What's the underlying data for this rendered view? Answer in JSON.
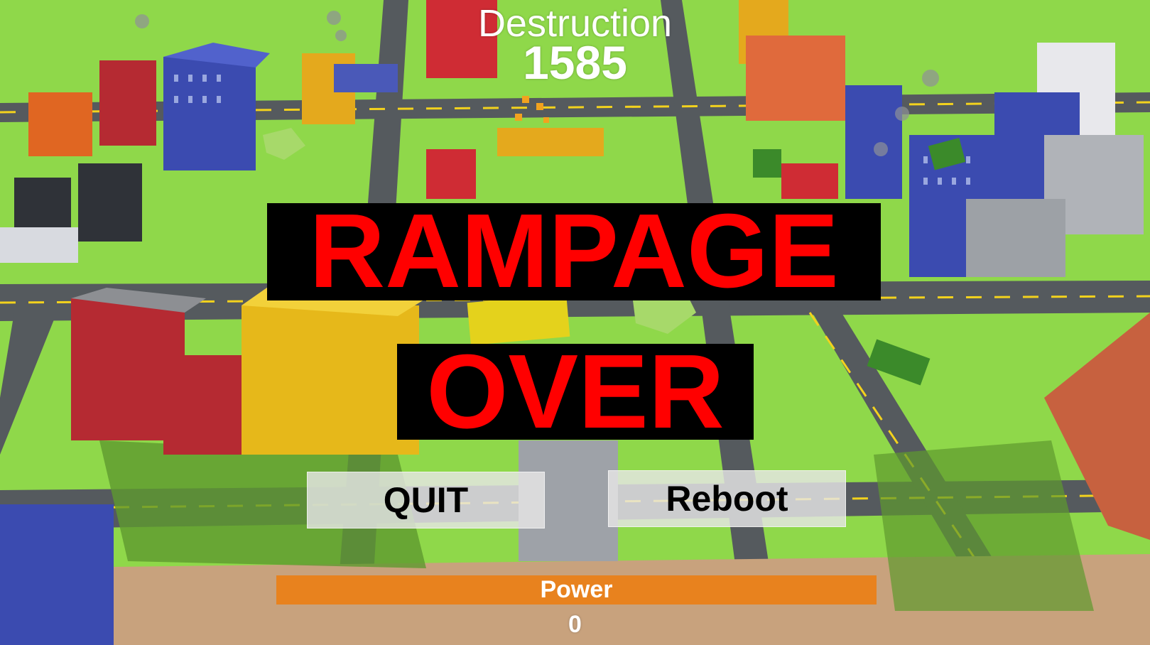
{
  "hud": {
    "destruction_label": "Destruction",
    "destruction_value": "1585",
    "power_label": "Power",
    "power_value": "0"
  },
  "game_over": {
    "line_1": "RAMPAGE",
    "line_2": "OVER"
  },
  "buttons": {
    "quit_label": "QUIT",
    "reboot_label": "Reboot"
  },
  "colors": {
    "grass": "#8fd84a",
    "road": "#555a5e",
    "banner_text": "#ff0000",
    "banner_bg": "#000000",
    "power_bar": "#e8821e"
  }
}
